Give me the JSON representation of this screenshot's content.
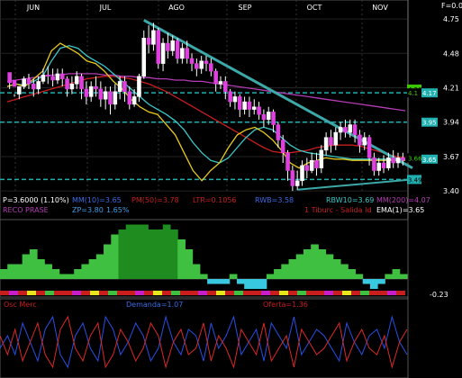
{
  "chart_data": {
    "type": "candlestick",
    "scale_label": "F=0.0",
    "months": [
      "JUN",
      "JUL",
      "AGO",
      "SEP",
      "OCT",
      "NOV"
    ],
    "y_ticks": [
      4.75,
      4.48,
      4.21,
      3.94,
      3.67,
      3.4
    ],
    "ylim": [
      3.38,
      4.8
    ],
    "price_tags": [
      {
        "value": 4.2,
        "text": "4.20",
        "bg": "#3cc800",
        "fg": "#000000"
      },
      {
        "value": 4.17,
        "text": "4.1",
        "bg": "#000000",
        "fg": "#3cc800"
      },
      {
        "value": 4.17,
        "text": "4.17",
        "bg": "#20b0b0",
        "fg": "#ffffff",
        "side": "axis"
      },
      {
        "value": 3.94,
        "text": "3.95",
        "bg": "#20b0b0",
        "fg": "#ffffff",
        "side": "axis"
      },
      {
        "value": 3.66,
        "text": "3.66",
        "bg": "#000000",
        "fg": "#3cc800"
      },
      {
        "value": 3.65,
        "text": "3.65",
        "bg": "#20b0b0",
        "fg": "#ffffff",
        "side": "axis"
      },
      {
        "value": 3.49,
        "text": "3.49",
        "bg": "#20b0b0",
        "fg": "#000000"
      }
    ],
    "hlines": [
      {
        "value": 4.17,
        "color": "#20b0b0"
      },
      {
        "value": 3.94,
        "color": "#20b0b0"
      },
      {
        "value": 3.49,
        "color": "#20b0b0"
      }
    ],
    "candles": [
      [
        4.33,
        4.25,
        4.27,
        4.2
      ],
      [
        4.27,
        4.22,
        4.16,
        4.14
      ],
      [
        4.16,
        4.22,
        4.16,
        4.12
      ],
      [
        4.22,
        4.28,
        4.3,
        4.2
      ],
      [
        4.28,
        4.24,
        4.32,
        4.2
      ],
      [
        4.24,
        4.2,
        4.28,
        4.14
      ],
      [
        4.2,
        4.26,
        4.3,
        4.16
      ],
      [
        4.26,
        4.31,
        4.36,
        4.24
      ],
      [
        4.31,
        4.3,
        4.38,
        4.24
      ],
      [
        4.3,
        4.27,
        4.36,
        4.22
      ],
      [
        4.27,
        4.32,
        4.36,
        4.24
      ],
      [
        4.32,
        4.28,
        4.36,
        4.22
      ],
      [
        4.28,
        4.2,
        4.3,
        4.14
      ],
      [
        4.2,
        4.24,
        4.3,
        4.16
      ],
      [
        4.24,
        4.3,
        4.34,
        4.2
      ],
      [
        4.3,
        4.2,
        4.32,
        4.12
      ],
      [
        4.2,
        4.14,
        4.26,
        4.08
      ],
      [
        4.14,
        4.22,
        4.26,
        4.1
      ],
      [
        4.22,
        4.2,
        4.3,
        4.14
      ],
      [
        4.2,
        4.12,
        4.26,
        4.06
      ],
      [
        4.12,
        4.18,
        4.22,
        4.04
      ],
      [
        4.18,
        4.08,
        4.22,
        4.0
      ],
      [
        4.08,
        4.18,
        4.24,
        4.04
      ],
      [
        4.18,
        4.26,
        4.3,
        4.12
      ],
      [
        4.26,
        4.18,
        4.3,
        4.1
      ],
      [
        4.18,
        4.08,
        4.22,
        4.04
      ],
      [
        4.08,
        4.14,
        4.2,
        4.06
      ],
      [
        4.14,
        4.3,
        4.32,
        4.1
      ],
      [
        4.3,
        4.6,
        4.66,
        4.28
      ],
      [
        4.6,
        4.55,
        4.7,
        4.48
      ],
      [
        4.55,
        4.66,
        4.72,
        4.5
      ],
      [
        4.66,
        4.4,
        4.68,
        4.36
      ],
      [
        4.4,
        4.56,
        4.6,
        4.34
      ],
      [
        4.56,
        4.5,
        4.64,
        4.44
      ],
      [
        4.5,
        4.58,
        4.62,
        4.46
      ],
      [
        4.58,
        4.44,
        4.6,
        4.4
      ],
      [
        4.44,
        4.52,
        4.56,
        4.4
      ],
      [
        4.52,
        4.44,
        4.58,
        4.4
      ],
      [
        4.44,
        4.4,
        4.48,
        4.34
      ],
      [
        4.4,
        4.36,
        4.44,
        4.3
      ],
      [
        4.36,
        4.42,
        4.46,
        4.32
      ],
      [
        4.42,
        4.4,
        4.46,
        4.34
      ],
      [
        4.4,
        4.34,
        4.44,
        4.3
      ],
      [
        4.34,
        4.24,
        4.36,
        4.18
      ],
      [
        4.24,
        4.26,
        4.3,
        4.2
      ],
      [
        4.26,
        4.18,
        4.3,
        4.12
      ],
      [
        4.18,
        4.1,
        4.2,
        4.06
      ],
      [
        4.1,
        4.14,
        4.18,
        4.04
      ],
      [
        4.14,
        4.04,
        4.16,
        3.98
      ],
      [
        4.04,
        4.1,
        4.14,
        4.0
      ],
      [
        4.1,
        4.04,
        4.14,
        3.98
      ],
      [
        4.04,
        4.06,
        4.12,
        4.0
      ],
      [
        4.06,
        4.0,
        4.1,
        3.96
      ],
      [
        4.0,
        3.96,
        4.04,
        3.9
      ],
      [
        3.96,
        4.02,
        4.06,
        3.92
      ],
      [
        4.02,
        3.92,
        4.04,
        3.86
      ],
      [
        3.92,
        3.8,
        3.94,
        3.74
      ],
      [
        3.8,
        3.7,
        3.84,
        3.62
      ],
      [
        3.7,
        3.56,
        3.72,
        3.48
      ],
      [
        3.56,
        3.44,
        3.6,
        3.4
      ],
      [
        3.44,
        3.48,
        3.56,
        3.41
      ],
      [
        3.48,
        3.6,
        3.64,
        3.44
      ],
      [
        3.6,
        3.56,
        3.66,
        3.5
      ],
      [
        3.56,
        3.64,
        3.7,
        3.54
      ],
      [
        3.64,
        3.58,
        3.7,
        3.52
      ],
      [
        3.58,
        3.72,
        3.76,
        3.54
      ],
      [
        3.72,
        3.82,
        3.86,
        3.68
      ],
      [
        3.82,
        3.76,
        3.88,
        3.7
      ],
      [
        3.76,
        3.86,
        3.9,
        3.72
      ],
      [
        3.86,
        3.9,
        3.94,
        3.8
      ],
      [
        3.9,
        3.86,
        3.96,
        3.82
      ],
      [
        3.86,
        3.92,
        3.96,
        3.82
      ],
      [
        3.92,
        3.84,
        3.96,
        3.78
      ],
      [
        3.84,
        3.76,
        3.88,
        3.7
      ],
      [
        3.76,
        3.82,
        3.86,
        3.72
      ],
      [
        3.82,
        3.66,
        3.84,
        3.6
      ],
      [
        3.66,
        3.56,
        3.7,
        3.52
      ],
      [
        3.56,
        3.62,
        3.66,
        3.52
      ],
      [
        3.62,
        3.58,
        3.68,
        3.54
      ],
      [
        3.58,
        3.66,
        3.7,
        3.56
      ],
      [
        3.66,
        3.62,
        3.72,
        3.58
      ],
      [
        3.62,
        3.66,
        3.7,
        3.58
      ],
      [
        3.66,
        3.64,
        3.7,
        3.6
      ]
    ],
    "overlays": [
      {
        "name": "PM(50)",
        "color": "#c81e1e",
        "values": [
          4.1,
          4.12,
          4.14,
          4.16,
          4.18,
          4.2,
          4.22,
          4.24,
          4.26,
          4.28,
          4.29,
          4.3,
          4.3,
          4.29,
          4.28,
          4.26,
          4.24,
          4.21,
          4.18,
          4.14,
          4.1,
          4.06,
          4.02,
          3.98,
          3.94,
          3.9,
          3.86,
          3.82,
          3.78,
          3.74,
          3.71,
          3.7,
          3.7,
          3.71,
          3.72,
          3.74,
          3.75,
          3.76,
          3.76,
          3.76,
          3.75,
          3.73,
          3.71,
          3.69,
          3.67,
          3.66
        ]
      },
      {
        "name": "MM(200)",
        "color": "#b43cb4",
        "values": [
          4.26,
          4.27,
          4.28,
          4.29,
          4.3,
          4.31,
          4.31,
          4.32,
          4.32,
          4.32,
          4.32,
          4.31,
          4.31,
          4.3,
          4.3,
          4.29,
          4.29,
          4.28,
          4.28,
          4.27,
          4.27,
          4.26,
          4.26,
          4.25,
          4.24,
          4.23,
          4.22,
          4.21,
          4.2,
          4.19,
          4.18,
          4.17,
          4.16,
          4.15,
          4.14,
          4.13,
          4.12,
          4.11,
          4.1,
          4.09,
          4.08,
          4.07,
          4.06,
          4.05,
          4.04,
          4.03
        ]
      },
      {
        "name": "RBW(10)",
        "color": "#3cc8c8",
        "values": [
          4.22,
          4.24,
          4.23,
          4.26,
          4.3,
          4.42,
          4.52,
          4.54,
          4.52,
          4.46,
          4.42,
          4.38,
          4.32,
          4.26,
          4.2,
          4.14,
          4.08,
          4.04,
          4.0,
          3.95,
          3.88,
          3.78,
          3.7,
          3.64,
          3.62,
          3.66,
          3.74,
          3.82,
          3.88,
          3.9,
          3.88,
          3.82,
          3.76,
          3.72,
          3.7,
          3.69,
          3.68,
          3.67,
          3.66,
          3.65,
          3.65,
          3.65,
          3.65,
          3.65,
          3.65,
          3.65
        ]
      },
      {
        "name": "EMA(1)",
        "color": "#e6c81e",
        "values": [
          4.22,
          4.24,
          4.22,
          4.28,
          4.34,
          4.5,
          4.56,
          4.52,
          4.48,
          4.42,
          4.4,
          4.34,
          4.26,
          4.2,
          4.12,
          4.06,
          4.02,
          4.0,
          3.92,
          3.84,
          3.7,
          3.56,
          3.48,
          3.56,
          3.62,
          3.74,
          3.84,
          3.88,
          3.9,
          3.86,
          3.8,
          3.72,
          3.62,
          3.58,
          3.62,
          3.64,
          3.66,
          3.65,
          3.65,
          3.64,
          3.64,
          3.64,
          3.64,
          3.64,
          3.64,
          3.64
        ]
      }
    ],
    "trendline": {
      "from": [
        28,
        4.74
      ],
      "to": [
        84,
        3.58
      ],
      "color": "#3ca8a8"
    },
    "supportline": {
      "from": [
        60,
        3.41
      ],
      "to": [
        84,
        3.49
      ],
      "color": "#3ca8a8"
    },
    "legend_row1": [
      {
        "text": "P=3.6000 (1.10%)",
        "color": "#ffffff"
      },
      {
        "text": "MM(10)=3.65",
        "color": "#3c6ce6"
      },
      {
        "text": "PM(50)=3.78",
        "color": "#c81e1e"
      },
      {
        "text": "LTR=0.1056",
        "color": "#c81e1e"
      },
      {
        "text": "RWB=3.58",
        "color": "#3c6ce6"
      },
      {
        "text": "RBW10=3.69",
        "color": "#3cc8c8"
      },
      {
        "text": "MM(200)=4.07",
        "color": "#b43cb4"
      }
    ],
    "legend_row2": [
      {
        "text": "RECO PRASE",
        "color": "#b43cb4"
      },
      {
        "text": "ZP=3.80",
        "color": "#3c9ce6"
      },
      {
        "text": "1.65%",
        "color": "#3c9ce6"
      },
      {
        "text": "1 Tiburc - Salida Id",
        "color": "#c81e1e"
      },
      {
        "text": "EMA(1)=3.65",
        "color": "#ffffff"
      }
    ],
    "volume_panel": {
      "low_label": "-0.23",
      "values": [
        0.2,
        0.3,
        0.3,
        0.5,
        0.6,
        0.4,
        0.3,
        0.2,
        0.1,
        0.1,
        0.2,
        0.3,
        0.4,
        0.5,
        0.7,
        0.9,
        1.0,
        1.1,
        1.1,
        1.1,
        1.0,
        1.0,
        1.1,
        1.0,
        0.8,
        0.6,
        0.3,
        0.1,
        -0.1,
        -0.1,
        -0.1,
        0.1,
        -0.1,
        -0.2,
        -0.2,
        -0.2,
        0.1,
        0.2,
        0.3,
        0.4,
        0.5,
        0.6,
        0.7,
        0.6,
        0.5,
        0.4,
        0.3,
        0.2,
        0.1,
        -0.1,
        -0.2,
        -0.1,
        0.1,
        0.2,
        0.1
      ]
    },
    "oscillator": {
      "labels": [
        {
          "text": "Osc Merc",
          "color": "#c81e1e"
        },
        {
          "text": "Demanda=1.07",
          "color": "#3c6ce6"
        },
        {
          "text": "Oferta=1.36",
          "color": "#c81e1e"
        }
      ],
      "demanda": [
        0.4,
        0.6,
        0.3,
        0.8,
        0.5,
        0.2,
        0.7,
        0.9,
        0.3,
        0.1,
        0.6,
        0.8,
        0.4,
        0.2,
        0.9,
        0.7,
        0.3,
        0.5,
        0.8,
        0.6,
        0.2,
        0.4,
        0.9,
        0.5,
        0.3,
        0.7,
        0.6,
        0.2,
        0.8,
        0.4,
        0.6,
        0.9,
        0.3,
        0.5,
        0.7,
        0.2,
        0.8,
        0.6,
        0.4,
        0.9,
        0.3,
        0.5,
        0.7,
        0.6,
        0.4,
        0.2,
        0.8,
        0.5,
        0.3,
        0.6,
        0.7,
        0.4,
        0.9,
        0.5,
        0.3
      ],
      "oferta": [
        0.6,
        0.3,
        0.7,
        0.2,
        0.5,
        0.8,
        0.3,
        0.1,
        0.7,
        0.9,
        0.4,
        0.2,
        0.6,
        0.8,
        0.1,
        0.3,
        0.7,
        0.5,
        0.2,
        0.4,
        0.8,
        0.6,
        0.1,
        0.5,
        0.7,
        0.3,
        0.4,
        0.8,
        0.2,
        0.6,
        0.4,
        0.1,
        0.7,
        0.5,
        0.3,
        0.8,
        0.2,
        0.4,
        0.6,
        0.1,
        0.7,
        0.5,
        0.3,
        0.4,
        0.6,
        0.8,
        0.2,
        0.5,
        0.7,
        0.4,
        0.3,
        0.6,
        0.1,
        0.5,
        0.7
      ]
    }
  }
}
